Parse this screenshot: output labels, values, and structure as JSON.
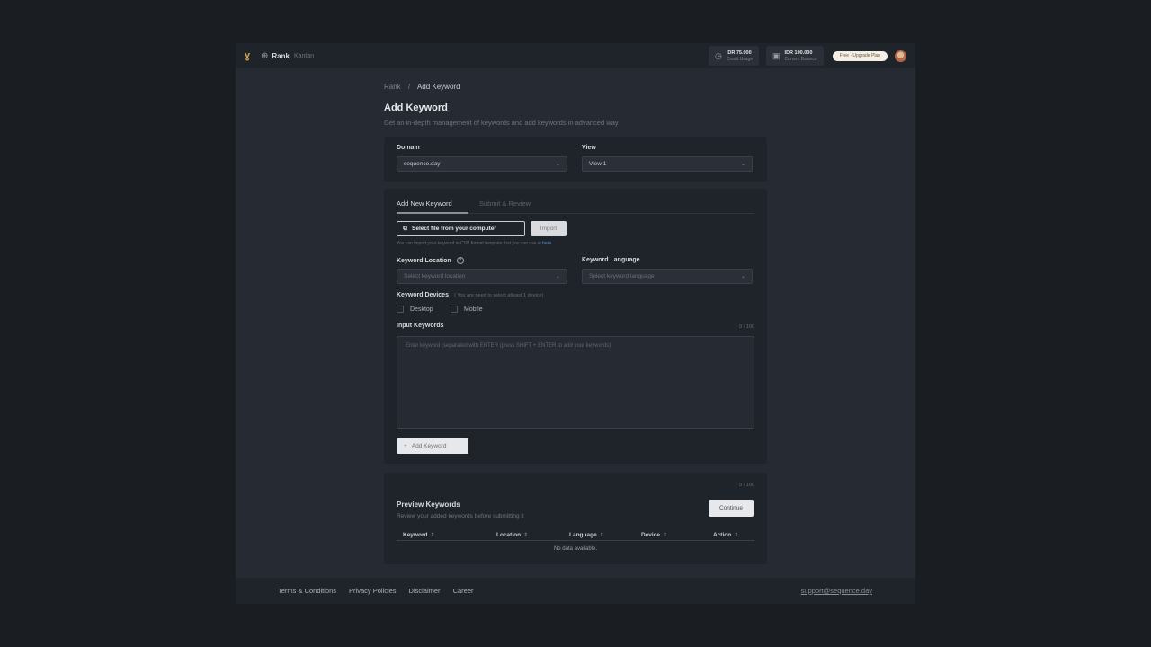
{
  "header": {
    "brand": "Rank",
    "brand_sub": "Kantan",
    "credit_usage": {
      "value": "IDR 75.000",
      "label": "Credit Usage"
    },
    "current_balance": {
      "value": "IDR 100.000",
      "label": "Current Balance"
    },
    "plan_label": "Free · Upgrade Plan"
  },
  "breadcrumb": {
    "parent": "Rank",
    "separator": "/",
    "current": "Add Keyword"
  },
  "page": {
    "title": "Add Keyword",
    "subtitle": "Get an in-depth management of keywords and add keywords in advanced way"
  },
  "domain_card": {
    "domain_label": "Domain",
    "domain_value": "sequence.day",
    "view_label": "View",
    "view_value": "View 1"
  },
  "keyword_card": {
    "tabs": [
      {
        "label": "Add New Keyword",
        "active": true
      },
      {
        "label": "Submit & Review",
        "active": false
      }
    ],
    "select_file_label": "Select file from your computer",
    "import_label": "Import",
    "import_hint": "You can import your keyword in CSV format template that you can use in",
    "import_hint_link": "here",
    "location_label": "Keyword Location",
    "location_placeholder": "Select keyword location",
    "language_label": "Keyword Language",
    "language_placeholder": "Select keyword language",
    "devices_label": "Keyword Devices",
    "devices_hint": "( You are need to select atleast 1 device)",
    "devices": [
      {
        "label": "Desktop",
        "checked": false
      },
      {
        "label": "Mobile",
        "checked": false
      }
    ],
    "input_label": "Input Keywords",
    "input_counter": "0 / 100",
    "input_placeholder": "Enter keyword (separated with ENTER (press SHIFT + ENTER to add your keywords)",
    "add_button_label": "Add Keyword"
  },
  "preview_card": {
    "counter": "0 / 100",
    "title": "Preview Keywords",
    "subtitle": "Review your added keywords before submitting it",
    "continue_label": "Continue",
    "columns": [
      "Keyword",
      "Location",
      "Language",
      "Device",
      "Action"
    ],
    "empty_text": "No data available."
  },
  "footer": {
    "links": [
      "Terms & Conditions",
      "Privacy Policies",
      "Disclaimer",
      "Career"
    ],
    "email": "support@sequence.day"
  }
}
